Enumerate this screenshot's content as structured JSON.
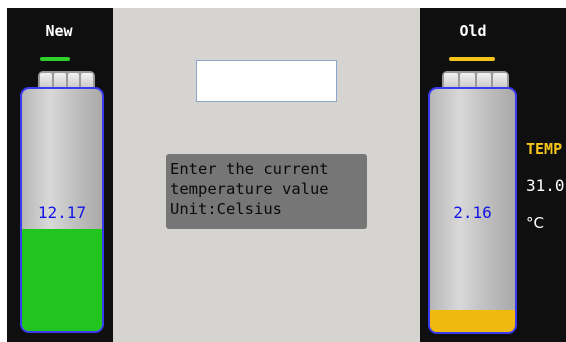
{
  "new_battery": {
    "title": "New",
    "value": "12.17",
    "fill_fraction": 0.42,
    "fill_color": "#22c51d",
    "indicator_color": "#2fd12a"
  },
  "old_battery": {
    "title": "Old",
    "value": "2.16",
    "fill_fraction": 0.09,
    "fill_color": "#f0b90f",
    "indicator_color": "#f5c51c"
  },
  "input": {
    "value": ""
  },
  "prompt": {
    "text": "Enter the current\ntemperature value\nUnit:Celsius"
  },
  "temperature": {
    "label": "TEMP",
    "value": "31.0",
    "unit": "°C"
  },
  "colors": {
    "battery_border": "#3a3af0",
    "value_text": "#1414e6",
    "temp_label": "#f5c51c"
  }
}
